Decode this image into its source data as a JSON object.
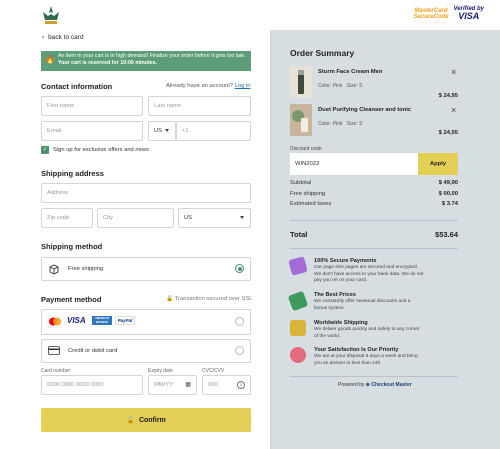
{
  "header": {
    "mastercard": {
      "line1": "MasterCard",
      "line2": "SecureCode"
    },
    "visa": {
      "line1": "Verified by",
      "line2": "VISA"
    }
  },
  "back_link": "back to card",
  "alert": {
    "text": "An item in your cart is in high demand! Finalize your order before it gets too late.",
    "reserved": "Your cart is reserved for 10:00 minutes."
  },
  "contact": {
    "title": "Contact information",
    "have_account": "Already have an account?",
    "login": "Log in",
    "first_name": "First name",
    "last_name": "Last name",
    "email": "Email",
    "phone_country": "US",
    "phone_prefix": "+1",
    "newsletter": "Sign up for exclusive offers and news"
  },
  "shipping": {
    "title": "Shipping address",
    "address": "Address",
    "zip": "Zip code",
    "city": "City",
    "country": "US"
  },
  "shipping_method": {
    "title": "Shipping method",
    "option": "Free shipping"
  },
  "payment": {
    "title": "Payment method",
    "secure": "Transaction secured over SSL",
    "card_option": "Credit or debit card",
    "card_number_label": "Card number",
    "card_number_placeholder": "0000 0000 0000 0000",
    "expiry_label": "Expiry date",
    "expiry_placeholder": "MM/YY",
    "cvc_label": "CVC/CVV",
    "cvc_placeholder": "000",
    "brands": {
      "visa": "VISA",
      "amex": "AMERICAN EXPRESS",
      "paypal": "PayPal"
    },
    "confirm": "Confirm"
  },
  "summary": {
    "title": "Order Summary",
    "items": [
      {
        "name": "Sturm Face Cream Men",
        "color": "Color: Pink",
        "size": "Size: S",
        "price": "$ 24,95"
      },
      {
        "name": "Duet Purifying Cleanser and tonic",
        "color": "Color: Pink",
        "size": "Size: S",
        "price": "$ 24,95"
      }
    ],
    "discount_label": "Discount code",
    "discount_value": "WIN2023",
    "apply": "Apply",
    "subtotal_label": "Subtotal",
    "subtotal": "$ 49,90",
    "shipping_label": "Free shipping",
    "shipping": "$ 00,00",
    "taxes_label": "Estimated taxes",
    "taxes": "$ 3.74",
    "total_label": "Total",
    "total": "$53.64"
  },
  "features": [
    {
      "title": "100% Secure Payments",
      "text": "Our page size pages are secured and encrypted. We don't have access to your bank data. We do not pay you ret on your card."
    },
    {
      "title": "The Best Prices",
      "text": "We constantly offer seasonal discounts and a bonus system."
    },
    {
      "title": "Worldwide Shipping",
      "text": "We deliver goods quickly and safely to any corner of the world."
    },
    {
      "title": "Your Satisfaction Is Our Priority",
      "text": "We are at your disposal 6 days a week and bring you an answer in less than 24h."
    }
  ],
  "powered": {
    "prefix": "Powered by",
    "brand": "Checkout Master"
  },
  "colors": {
    "accent_green": "#4c8f6a",
    "button_yellow": "#e3cf55",
    "summary_bg": "#d7dee2"
  }
}
